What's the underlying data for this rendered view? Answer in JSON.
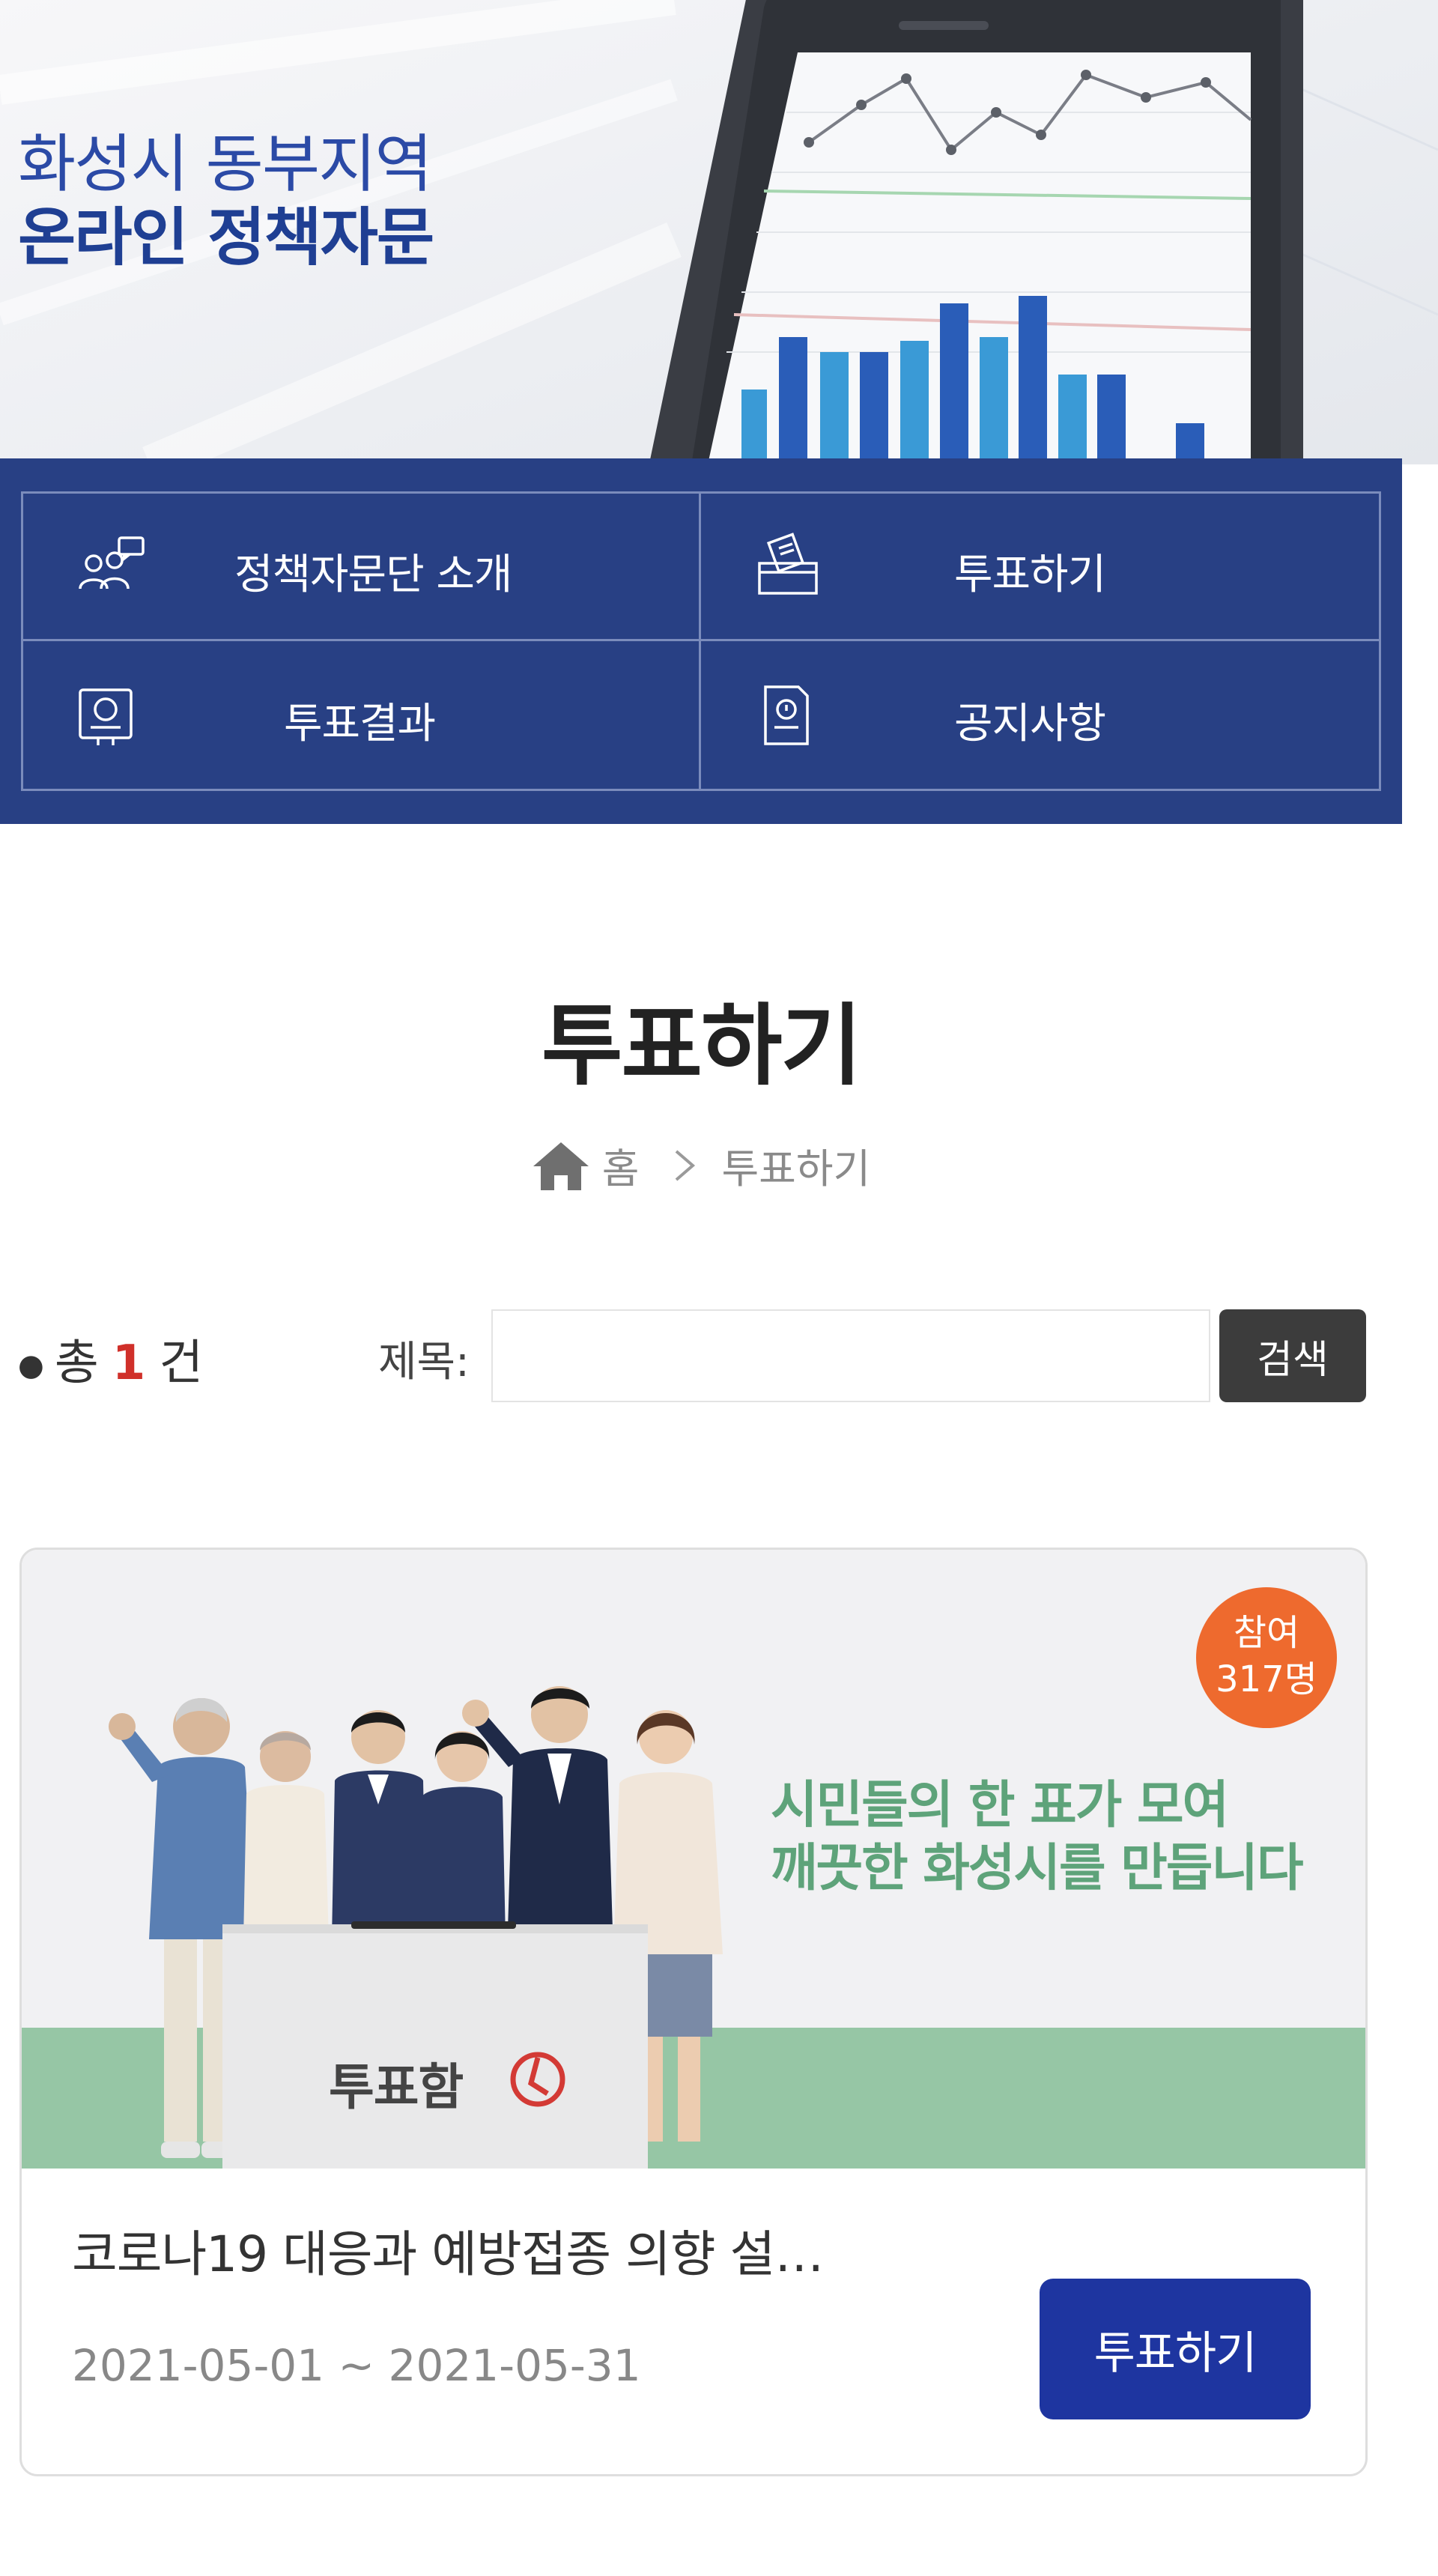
{
  "hero": {
    "title_line1": "화성시 동부지역",
    "title_line2": "온라인 정책자문"
  },
  "menu": {
    "items": [
      {
        "label": "정책자문단 소개",
        "icon": "people-chat-icon"
      },
      {
        "label": "투표하기",
        "icon": "ballot-box-icon"
      },
      {
        "label": "투표결과",
        "icon": "result-board-icon"
      },
      {
        "label": "공지사항",
        "icon": "notice-document-icon"
      }
    ]
  },
  "page": {
    "title": "투표하기",
    "breadcrumb": {
      "home": "홈",
      "current": "투표하기"
    }
  },
  "list": {
    "count_prefix": "총",
    "count_value": "1",
    "count_suffix": "건",
    "search_label": "제목:",
    "search_value": "",
    "search_button": "검색"
  },
  "card": {
    "badge_line1": "참여",
    "badge_line2": "317명",
    "slogan_line1": "시민들의 한 표가 모여",
    "slogan_line2": "깨끗한 화성시를 만듭니다",
    "ballot_box_label": "투표함",
    "title": "코로나19 대응과 예방접종 의향 설…",
    "dates": "2021-05-01 ~ 2021-05-31",
    "button": "투표하기"
  },
  "colors": {
    "menu_bg": "#284084",
    "hero_title": "#1f3f93",
    "count_highlight": "#d0302a",
    "badge": "#ee6a2e",
    "slogan": "#5ea37a",
    "vote_button": "#1e35a0"
  }
}
